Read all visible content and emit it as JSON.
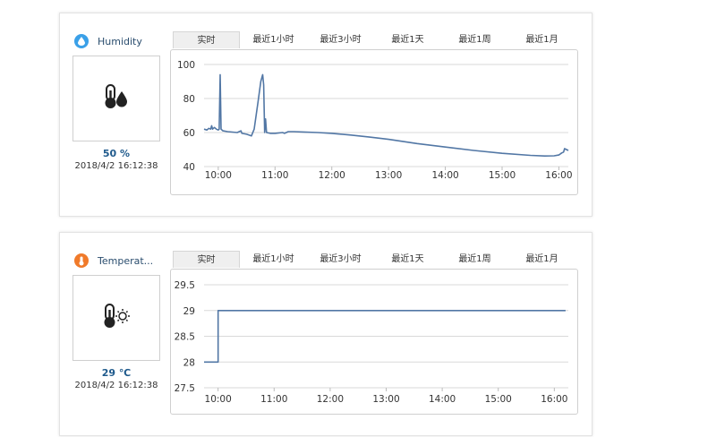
{
  "panels": [
    {
      "id": "humidity",
      "title": "Humidity",
      "value": "50 %",
      "timestamp": "2018/4/2 16:12:38",
      "icon_color": "#3aa0e8",
      "header_icon": "water-drop-icon",
      "box_icon": "thermometer-drop-icon"
    },
    {
      "id": "temperature",
      "title": "Temperat...",
      "value": "29 ℃",
      "timestamp": "2018/4/2 16:12:38",
      "icon_color": "#f07a2a",
      "header_icon": "thermometer-icon",
      "box_icon": "thermometer-sun-icon"
    }
  ],
  "tabs": [
    "实时",
    "最近1小时",
    "最近3小时",
    "最近1天",
    "最近1周",
    "最近1月"
  ],
  "active_tab": 0,
  "line_color": "#5277a5",
  "chart_data": [
    {
      "type": "line",
      "ylim": [
        40,
        100
      ],
      "yticks": [
        "40",
        "60",
        "80",
        "100"
      ],
      "xlim": [
        "09:45",
        "16:10"
      ],
      "xticks": [
        "10:00",
        "11:00",
        "12:00",
        "13:00",
        "14:00",
        "15:00",
        "16:00"
      ],
      "points": [
        [
          "09:45",
          62
        ],
        [
          "09:48",
          61.5
        ],
        [
          "09:50",
          62.5
        ],
        [
          "09:52",
          62
        ],
        [
          "09:53",
          64
        ],
        [
          "09:54",
          62
        ],
        [
          "09:56",
          63
        ],
        [
          "09:58",
          62
        ],
        [
          "10:00",
          61.5
        ],
        [
          "10:01",
          62
        ],
        [
          "10:02",
          94
        ],
        [
          "10:03",
          62
        ],
        [
          "10:05",
          61
        ],
        [
          "10:10",
          60.5
        ],
        [
          "10:20",
          60
        ],
        [
          "10:24",
          61
        ],
        [
          "10:25",
          59.5
        ],
        [
          "10:30",
          59
        ],
        [
          "10:35",
          58
        ],
        [
          "10:38",
          62
        ],
        [
          "10:42",
          78
        ],
        [
          "10:45",
          90
        ],
        [
          "10:47",
          94
        ],
        [
          "10:48",
          88
        ],
        [
          "10:49",
          60
        ],
        [
          "10:50",
          68
        ],
        [
          "10:51",
          60
        ],
        [
          "10:55",
          59.5
        ],
        [
          "11:00",
          59.5
        ],
        [
          "11:08",
          60
        ],
        [
          "11:10",
          59.5
        ],
        [
          "11:14",
          60.5
        ],
        [
          "11:20",
          60.5
        ],
        [
          "11:30",
          60.3
        ],
        [
          "11:45",
          60
        ],
        [
          "12:00",
          59.5
        ],
        [
          "12:20",
          58.5
        ],
        [
          "12:40",
          57.3
        ],
        [
          "13:00",
          56
        ],
        [
          "13:30",
          53.5
        ],
        [
          "14:00",
          51.5
        ],
        [
          "14:30",
          49.5
        ],
        [
          "15:00",
          47.8
        ],
        [
          "15:30",
          46.6
        ],
        [
          "15:45",
          46.2
        ],
        [
          "15:55",
          46.3
        ],
        [
          "16:00",
          46.8
        ],
        [
          "16:03",
          48
        ],
        [
          "16:05",
          48.5
        ],
        [
          "16:06",
          50.5
        ],
        [
          "16:08",
          50
        ],
        [
          "16:10",
          49.5
        ]
      ]
    },
    {
      "type": "line",
      "ylim": [
        27.5,
        29.5
      ],
      "yticks": [
        "27.5",
        "28",
        "28.5",
        "29",
        "29.5"
      ],
      "xlim": [
        "09:45",
        "16:15"
      ],
      "xticks": [
        "10:00",
        "11:00",
        "12:00",
        "13:00",
        "14:00",
        "15:00",
        "16:00"
      ],
      "points": [
        [
          "09:45",
          28
        ],
        [
          "10:00",
          28
        ],
        [
          "10:00",
          29
        ],
        [
          "16:12",
          29
        ]
      ]
    }
  ]
}
